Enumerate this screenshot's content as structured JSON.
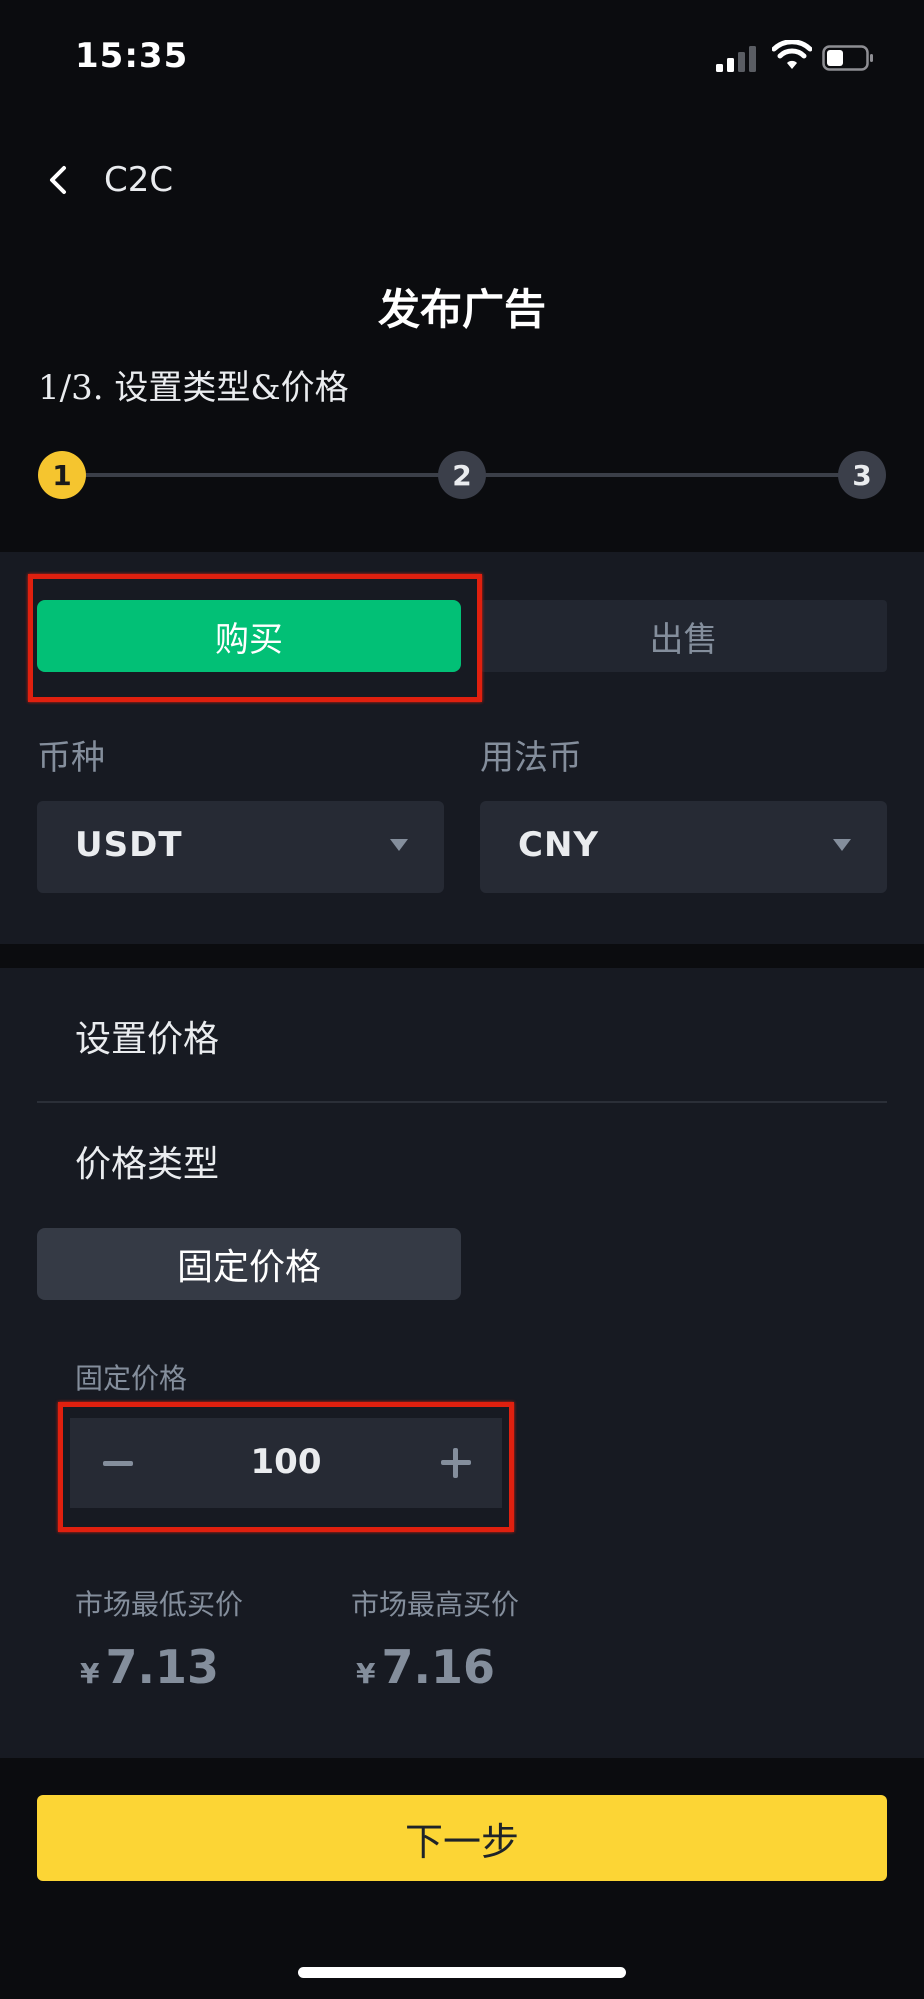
{
  "status_bar": {
    "time": "15:35"
  },
  "nav": {
    "back_label": "C2C"
  },
  "header": {
    "title": "发布广告",
    "step_title": "1/3. 设置类型&价格"
  },
  "stepper": {
    "steps": [
      "1",
      "2",
      "3"
    ],
    "current": 1
  },
  "trade_type": {
    "buy_label": "购买",
    "sell_label": "出售",
    "selected": "购买"
  },
  "crypto": {
    "label": "币种",
    "value": "USDT"
  },
  "fiat": {
    "label": "用法币",
    "value": "CNY"
  },
  "price": {
    "section_title": "设置价格",
    "type_label": "价格类型",
    "type_button": "固定价格",
    "input_label": "固定价格",
    "input_value": "100"
  },
  "market": {
    "low_label": "市场最低买价",
    "low_currency": "¥",
    "low_value": "7.13",
    "high_label": "市场最高买价",
    "high_currency": "¥",
    "high_value": "7.16"
  },
  "footer": {
    "next_label": "下一步"
  },
  "colors": {
    "accent_yellow": "#fcd535",
    "buy_green": "#02c076",
    "annotation_red": "#e0200f"
  }
}
